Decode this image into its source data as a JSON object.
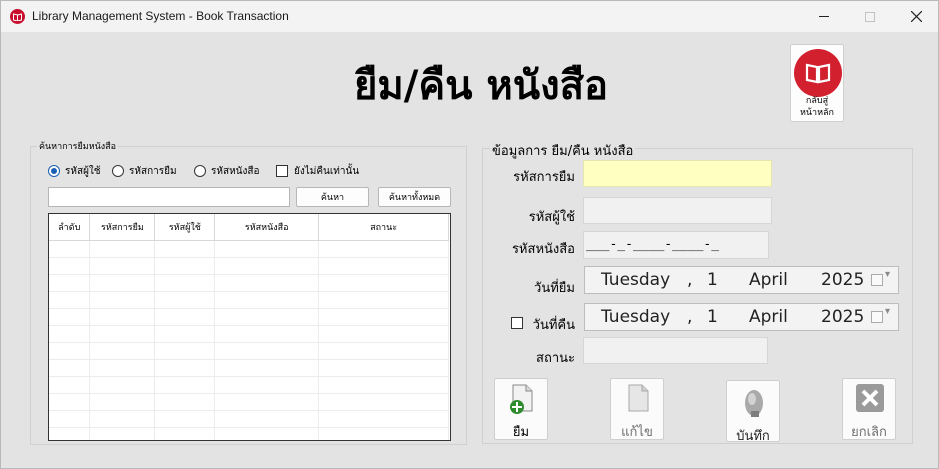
{
  "window": {
    "title": "Library Management System - Book Transaction",
    "controls": {
      "minimize": "—",
      "maximize": "☐",
      "close": "✕"
    }
  },
  "header": {
    "title": "ยืม/คืน หนังสือ",
    "home_button_label": "กลับสู่\nหน้าหลัก"
  },
  "search_panel": {
    "caption": "ค้นหาการยืมหนังสือ",
    "radios": [
      {
        "label": "รหัสผู้ใช้",
        "checked": true
      },
      {
        "label": "รหัสการยืม",
        "checked": false
      },
      {
        "label": "รหัสหนังสือ",
        "checked": false
      }
    ],
    "only_unreturned_label": "ยังไม่คืนเท่านั้น",
    "search_value": "",
    "search_button": "ค้นหา",
    "search_all_button": "ค้นหาทั้งหมด",
    "columns": [
      "ลำดับ",
      "รหัสการยืม",
      "รหัสผู้ใช้",
      "รหัสหนังสือ",
      "สถานะ"
    ]
  },
  "details_panel": {
    "caption": "ข้อมูลการ ยืม/คืน หนังสือ",
    "borrow_id_label": "รหัสการยืม",
    "user_id_label": "รหัสผู้ใช้",
    "book_id_label": "รหัสหนังสือ",
    "book_id_mask": "___-_-____-____-_",
    "borrow_date_label": "วันที่ยืม",
    "return_date_label": "วันที่คืน",
    "status_label": "สถานะ",
    "borrow_date": {
      "weekday": "Tuesday",
      "day": "1",
      "month": "April",
      "year": "2025"
    },
    "return_date": {
      "weekday": "Tuesday",
      "day": "1",
      "month": "April",
      "year": "2025"
    }
  },
  "actions": {
    "borrow": "ยืม",
    "edit": "แก้ไข",
    "save": "บันทึก",
    "cancel": "ยกเลิก"
  },
  "colors": {
    "accent_red": "#d2202f",
    "highlight_yellow": "#ffffc2"
  }
}
